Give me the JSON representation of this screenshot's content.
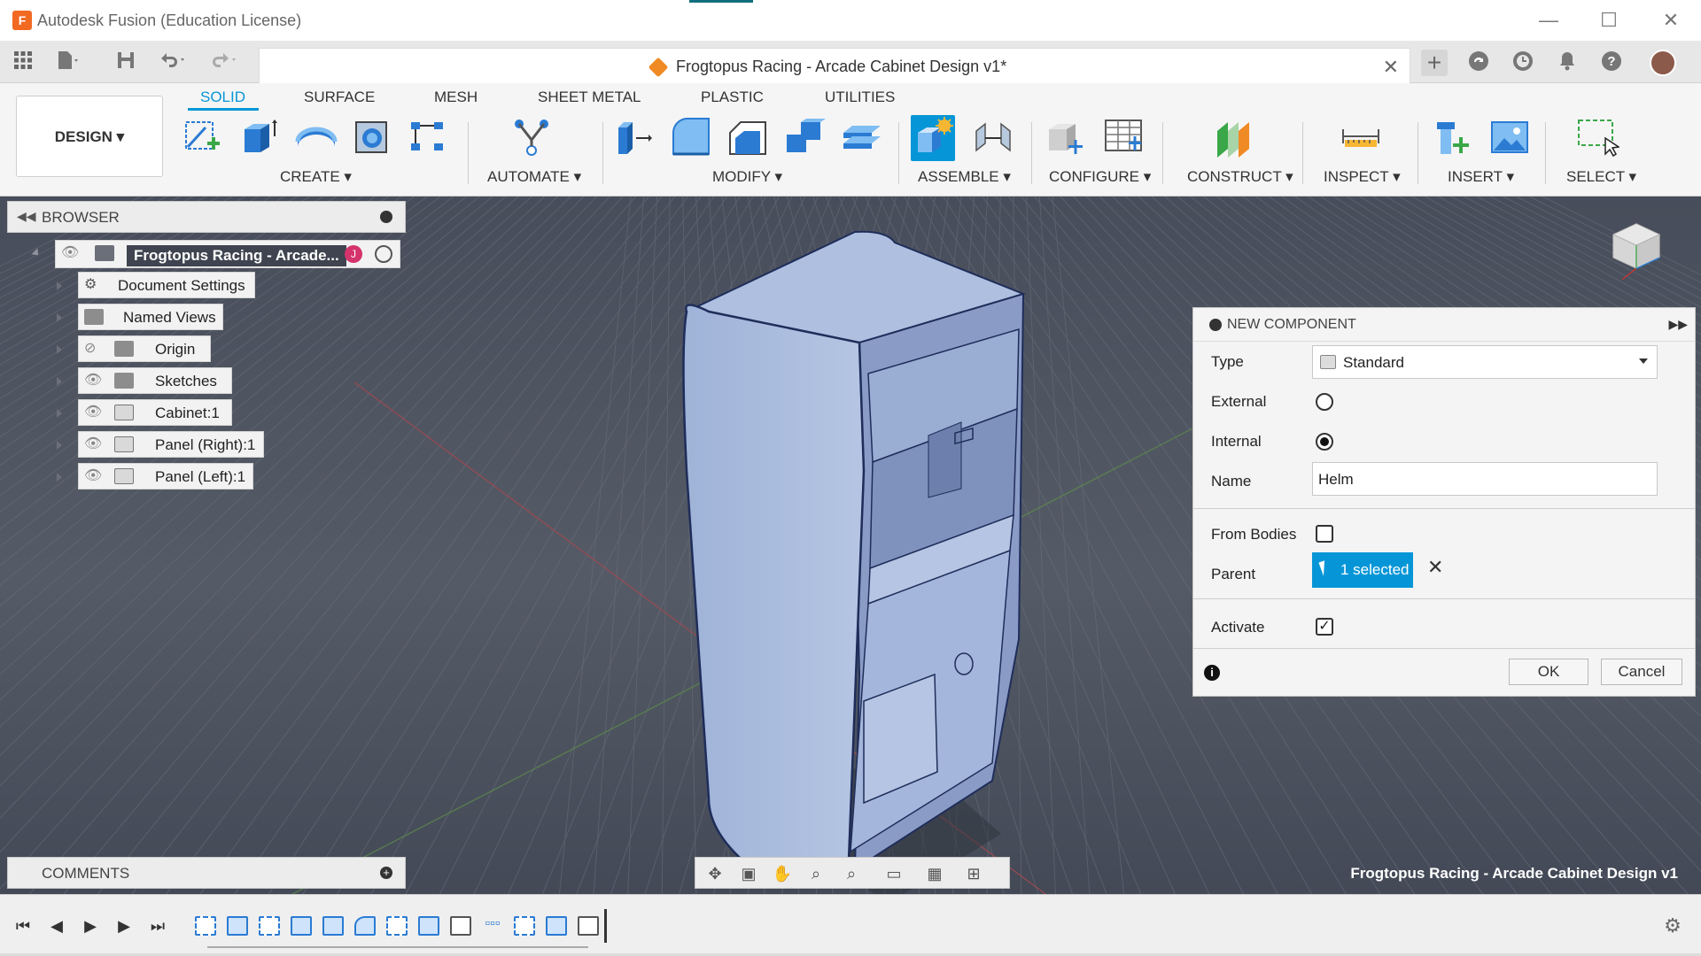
{
  "window": {
    "app_title": "Autodesk Fusion (Education License)",
    "app_icon_letter": "F",
    "minimize_glyph": "—",
    "maximize_glyph": "☐",
    "close_glyph": "✕"
  },
  "document_tab": {
    "title": "Frogtopus Racing - Arcade Cabinet Design v1*",
    "close_glyph": "✕"
  },
  "ribbon": {
    "workspace": "DESIGN ▾",
    "tabs": [
      "SOLID",
      "SURFACE",
      "MESH",
      "SHEET METAL",
      "PLASTIC",
      "UTILITIES"
    ],
    "active_tab": "SOLID",
    "groups": [
      "CREATE ▾",
      "AUTOMATE ▾",
      "MODIFY ▾",
      "ASSEMBLE ▾",
      "CONFIGURE ▾",
      "CONSTRUCT ▾",
      "INSPECT ▾",
      "INSERT ▾",
      "SELECT ▾"
    ]
  },
  "browser": {
    "title": "BROWSER",
    "root": "Frogtopus Racing - Arcade...",
    "items": [
      {
        "label": "Document Settings"
      },
      {
        "label": "Named Views"
      },
      {
        "label": "Origin"
      },
      {
        "label": "Sketches"
      },
      {
        "label": "Cabinet:1"
      },
      {
        "label": "Panel (Right):1"
      },
      {
        "label": "Panel (Left):1"
      }
    ]
  },
  "dialog": {
    "title": "NEW COMPONENT",
    "type_label": "Type",
    "type_value": "Standard",
    "external_label": "External",
    "external_checked": false,
    "internal_label": "Internal",
    "internal_checked": true,
    "name_label": "Name",
    "name_value": "Helm",
    "from_bodies_label": "From Bodies",
    "from_bodies_checked": false,
    "parent_label": "Parent",
    "parent_value": "1 selected",
    "activate_label": "Activate",
    "activate_checked": true,
    "ok_label": "OK",
    "cancel_label": "Cancel",
    "info_glyph": "i"
  },
  "comments": {
    "title": "COMMENTS",
    "plus_glyph": "+"
  },
  "viewport": {
    "document_label": "Frogtopus Racing - Arcade Cabinet Design v1",
    "model_color": "#a9bbdc",
    "model_edge_color": "#23325f",
    "background_color": "#4b515d"
  },
  "icons": {
    "titlebar": [
      "app-icon",
      "minimize-icon",
      "maximize-icon",
      "close-icon"
    ],
    "quick_access": [
      "grid-menu-icon",
      "file-icon",
      "save-icon",
      "undo-icon",
      "redo-icon"
    ],
    "top_right": [
      "new-tab-icon",
      "cloud-sync-icon",
      "clock-icon",
      "bell-icon",
      "help-icon",
      "avatar"
    ],
    "nav": [
      "orbit-icon",
      "look-at-icon",
      "pan-icon",
      "zoom-icon",
      "zoom-window-icon",
      "display-settings-icon",
      "grid-settings-icon",
      "viewports-icon"
    ],
    "timeline": [
      "go-start-icon",
      "step-back-icon",
      "play-icon",
      "step-forward-icon",
      "go-end-icon",
      "settings-gear-icon"
    ]
  }
}
